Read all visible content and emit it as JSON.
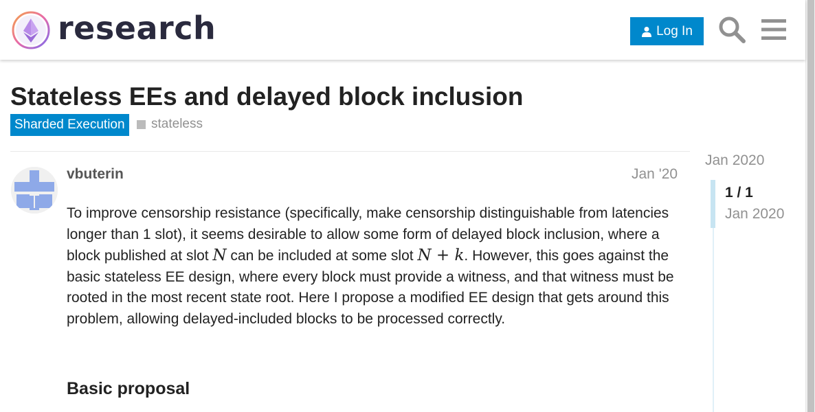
{
  "header": {
    "logo_text": "research",
    "login_label": "Log In"
  },
  "topic": {
    "title": "Stateless EEs and delayed block inclusion",
    "category": "Sharded Execution",
    "tag": "stateless"
  },
  "post": {
    "username": "vbuterin",
    "date": "Jan '20",
    "body_part1": "To improve censorship resistance (specifically, make censorship distinguishable from latencies longer than 1 slot), it seems desirable to allow some form of delayed block inclusion, where a block published at slot ",
    "math_n": "N",
    "body_part2": " can be included at some slot ",
    "math_nk": "N + k",
    "body_part3": ". However, this goes against the basic stateless EE design, where every block must provide a witness, and that witness must be rooted in the most recent state root. Here I propose a modified EE design that gets around this problem, allowing delayed-included blocks to be processed correctly.",
    "heading": "Basic proposal"
  },
  "timeline": {
    "top_date": "Jan 2020",
    "count": "1 / 1",
    "bottom_date": "Jan 2020"
  },
  "colors": {
    "accent": "#0088cc",
    "avatar": "#8ea9e8"
  },
  "icons": {
    "login": "user-icon",
    "search": "search-icon",
    "menu": "hamburger-menu-icon",
    "logo": "ethereum-research-logo"
  }
}
